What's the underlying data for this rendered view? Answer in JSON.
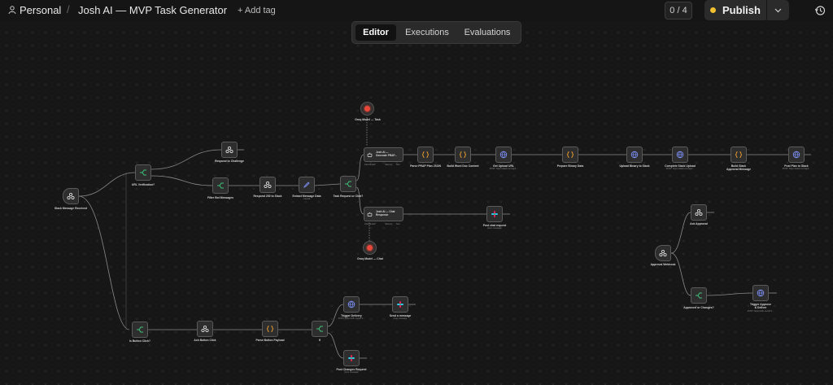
{
  "header": {
    "project": "Personal",
    "separator": "/",
    "workflow_name": "Josh AI — MVP Task Generator",
    "add_tag": "+ Add tag",
    "counter": "0 / 4",
    "publish": "Publish"
  },
  "tabs": [
    {
      "label": "Editor",
      "active": true
    },
    {
      "label": "Executions",
      "active": false
    },
    {
      "label": "Evaluations",
      "active": false
    }
  ],
  "colors": {
    "publish_dot": "#f2c12e",
    "model_core": "#e8483a",
    "accent_green": "#3ec27a",
    "accent_orange": "#f0a030",
    "accent_blue": "#7a8cf0"
  },
  "nodes": {
    "slack_received": {
      "label": "Slack Message Received",
      "icon": "webhook-icon"
    },
    "url_verification": {
      "label": "URL Verification?",
      "icon": "switch-icon"
    },
    "respond_challenge": {
      "label": "Respond to Challenge",
      "icon": "webhook-icon"
    },
    "filter_bot": {
      "label": "Filter Bot Messages",
      "icon": "switch-icon"
    },
    "respond_200": {
      "label": "Respond 200 to Slack",
      "icon": "webhook-icon"
    },
    "extract_message": {
      "label": "Extract Message Data",
      "sub": "manual",
      "icon": "pencil-icon"
    },
    "task_request": {
      "label": "Task Request or Chat?",
      "icon": "switch-icon"
    },
    "groq_task": {
      "label": "Groq Model — Task",
      "icon": "model-icon"
    },
    "groq_chat": {
      "label": "Groq Model — Chat",
      "icon": "model-icon"
    },
    "agent_generate": {
      "label": "Josh AI — Generate PRAP...",
      "sub_left": "Chat Model*",
      "sub_mid": "Memory",
      "sub_right": "Tool",
      "icon": "robot-icon"
    },
    "agent_chat": {
      "label": "Josh AI — Chat Response",
      "sub_left": "Chat Model*",
      "sub_mid": "Memory",
      "sub_right": "Tool",
      "icon": "robot-icon"
    },
    "parse_prap": {
      "label": "Parse PRAP Plan JSON",
      "icon": "code-icon"
    },
    "build_word": {
      "label": "Build Word Doc Content",
      "icon": "code-icon"
    },
    "get_upload": {
      "label": "Get Upload URL",
      "sub": "POST: https://slack.com/api/...",
      "icon": "globe-icon"
    },
    "prepare_binary": {
      "label": "Prepare Binary Data",
      "icon": "code-icon"
    },
    "upload_binary": {
      "label": "Upload Binary to Slack",
      "icon": "globe-icon"
    },
    "complete_upload": {
      "label": "Complete Slack Upload",
      "sub": "POST: https://slack.com/api/...",
      "icon": "globe-icon"
    },
    "build_approval": {
      "label": "Build Slack Approval Message",
      "icon": "code-icon"
    },
    "post_plan": {
      "label": "Post Plan to Slack",
      "sub": "POST: https://slack.com/api/...",
      "icon": "globe-icon"
    },
    "post_chat": {
      "label": "Post chat request",
      "sub": "post: message",
      "icon": "slack-icon"
    },
    "is_button": {
      "label": "Is Button Click?",
      "icon": "switch-icon"
    },
    "ack_button": {
      "label": "Ack Button Click",
      "icon": "webhook-icon"
    },
    "parse_button": {
      "label": "Parse Button Payload",
      "icon": "code-icon"
    },
    "if_node": {
      "label": "If",
      "icon": "switch-icon"
    },
    "trigger_delivery": {
      "label": "Trigger Delivery",
      "sub": "POST: https://n8n.srv1071...",
      "icon": "globe-icon"
    },
    "send_message": {
      "label": "Send a message",
      "sub": "post: message",
      "icon": "slack-icon"
    },
    "post_changes": {
      "label": "Post Changes Request",
      "sub": "post: message",
      "icon": "slack-icon"
    },
    "approval_webhook": {
      "label": "Approval Webhook",
      "icon": "webhook-icon"
    },
    "ack_approval": {
      "label": "Ack Approval",
      "icon": "webhook-icon"
    },
    "approved_or_changes": {
      "label": "Approved or Changes?",
      "icon": "switch-icon"
    },
    "trigger_approve": {
      "label": "Trigger Approve & Deliver",
      "sub": "POST: https://n8n.srv1071...",
      "icon": "globe-icon"
    }
  }
}
